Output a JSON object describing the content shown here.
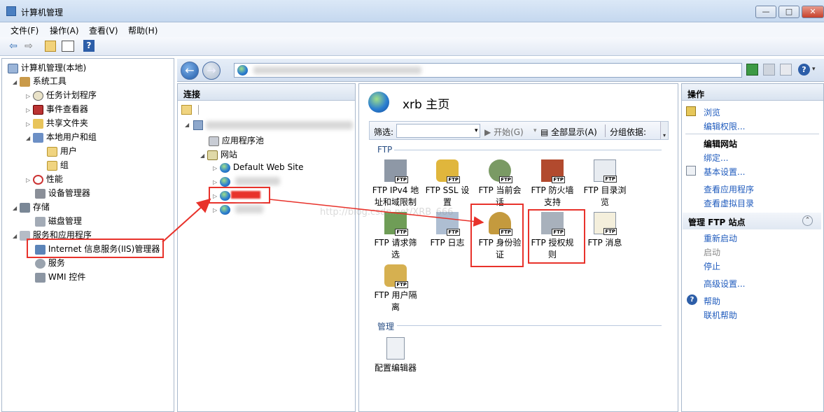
{
  "window": {
    "title": "计算机管理",
    "min": "—",
    "max": "□",
    "close": "✕"
  },
  "menubar": [
    "文件(F)",
    "操作(A)",
    "查看(V)",
    "帮助(H)"
  ],
  "left_tree": {
    "root": "计算机管理(本地)",
    "system_tools": "系统工具",
    "task_scheduler": "任务计划程序",
    "event_viewer": "事件查看器",
    "shared_folders": "共享文件夹",
    "local_users": "本地用户和组",
    "users": "用户",
    "groups": "组",
    "performance": "性能",
    "device_manager": "设备管理器",
    "storage": "存储",
    "disk_mgmt": "磁盘管理",
    "services_apps": "服务和应用程序",
    "iis": "Internet 信息服务(IIS)管理器",
    "services": "服务",
    "wmi": "WMI 控件"
  },
  "connections": {
    "header": "连接",
    "app_pools": "应用程序池",
    "sites": "网站",
    "default_site": "Default Web Site"
  },
  "main": {
    "title": "xrb 主页",
    "filter_label": "筛选:",
    "start_btn": "开始(G)",
    "show_all": "全部显示(A)",
    "group_by": "分组依据:",
    "ftp_section": "FTP",
    "mgmt_section": "管理",
    "features": [
      "FTP IPv4 地址和域限制",
      "FTP SSL 设置",
      "FTP 当前会话",
      "FTP 防火墙支持",
      "FTP 目录浏览",
      "FTP 请求筛选",
      "FTP 日志",
      "FTP 身份验证",
      "FTP 授权规则",
      "FTP 消息",
      "FTP 用户隔离"
    ],
    "config_editor": "配置编辑器",
    "ftp_tag": "FTP",
    "watermark": "http://blog.csdn.net/XRB_666"
  },
  "actions": {
    "header": "操作",
    "browse": "浏览",
    "edit_perm": "编辑权限...",
    "edit_site": "编辑网站",
    "bindings": "绑定...",
    "basic_settings": "基本设置...",
    "view_apps": "查看应用程序",
    "view_vdirs": "查看虚拟目录",
    "manage_ftp": "管理 FTP 站点",
    "restart": "重新启动",
    "start": "启动",
    "stop": "停止",
    "advanced": "高级设置...",
    "help": "帮助",
    "online_help": "联机帮助"
  }
}
